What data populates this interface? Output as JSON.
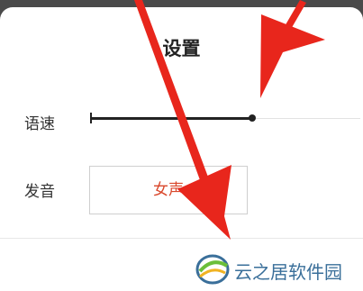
{
  "dialog": {
    "title": "设置"
  },
  "speech_rate": {
    "label": "语速",
    "value_fraction": 0.6
  },
  "voice": {
    "label": "发音",
    "selected": "女声"
  },
  "watermark": {
    "text": "云之居软件园"
  },
  "colors": {
    "annotation_arrow": "#e8261c",
    "selected_voice_text": "#d9472b"
  }
}
